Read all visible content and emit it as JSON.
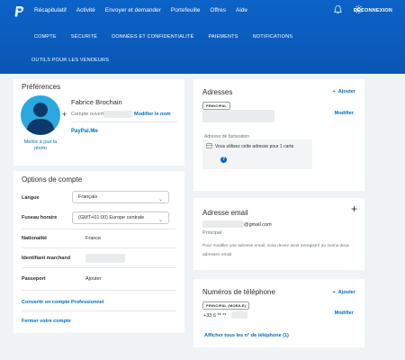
{
  "topnav": {
    "items": [
      "Récapitulatif",
      "Activité",
      "Envoyer et demander",
      "Portefeuille",
      "Offres",
      "Aide"
    ],
    "logout": "DÉCONNEXION"
  },
  "subnav": {
    "items": [
      "COMPTE",
      "SÉCURITÉ",
      "DONNÉES ET CONFIDENTIALITÉ",
      "PAIEMENTS",
      "NOTIFICATIONS"
    ],
    "sellers": "OUTILS POUR LES VENDEURS"
  },
  "preferences": {
    "title": "Préférences",
    "name": "Fabrice Brochain",
    "account_opened": "Compte ouvert",
    "edit_name": "Modifier le nom",
    "photo_link": "Mettre à jour la photo",
    "paypalme": "PayPal.Me"
  },
  "options": {
    "title": "Options de compte",
    "language_label": "Langue",
    "language_value": "Français",
    "timezone_label": "Fuseau horaire",
    "timezone_value": "(GMT+01:00) Europe centrale",
    "nationality_label": "Nationalité",
    "nationality_value": "France",
    "merchant_label": "Identifiant marchand",
    "passport_label": "Passeport",
    "passport_action": "Ajouter",
    "convert_link": "Convertir en compte Professionnel",
    "close_link": "Fermer votre compte"
  },
  "addresses": {
    "title": "Adresses",
    "add": "Ajouter",
    "badge": "PRINCIPAL",
    "edit": "Modifier",
    "billing": "Adresse de facturation",
    "notice": "Vous utilisez cette adresse pour 1 carte."
  },
  "email": {
    "title": "Adresse email",
    "address_suffix": "@gmail.com",
    "status": "Principal",
    "info": "Pour modifier une adresse email, vous devez avoir enregistré au moins deux adresses email."
  },
  "phones": {
    "title": "Numéros de téléphone",
    "add": "Ajouter",
    "badge": "PRINCIPAL (MOBILE)",
    "number": "+33 6 ** **",
    "edit": "Modifier",
    "show_all": "Afficher tous les n° de téléphone (1)"
  },
  "colors": {
    "brand": "#0c62c7",
    "link": "#0070ba",
    "avatar": "#29a9e0"
  }
}
